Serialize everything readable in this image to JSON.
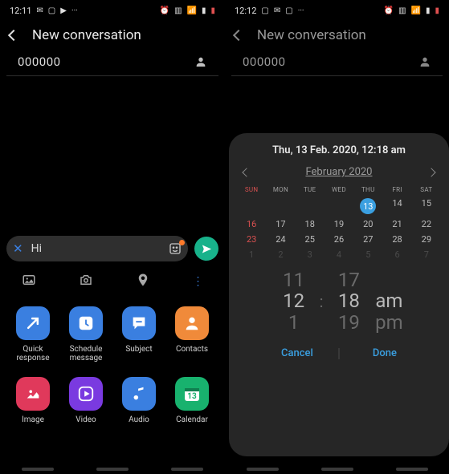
{
  "left": {
    "status": {
      "time": "12:11",
      "icons_left": [
        "📩",
        "▢",
        "▸",
        "···"
      ],
      "icons_right": [
        "⏰",
        "🗂",
        "📶",
        "📶",
        "🔋"
      ]
    },
    "header": {
      "title": "New conversation"
    },
    "recipient": {
      "value": "000000"
    },
    "compose": {
      "text": "Hi"
    },
    "toolbar": [
      "🖼",
      "📷",
      "📍",
      "⋮"
    ],
    "attachments": [
      {
        "label": "Quick\nresponse",
        "color": "c-blue",
        "icon": "↗"
      },
      {
        "label": "Schedule\nmessage",
        "color": "c-blue",
        "icon": "🕒"
      },
      {
        "label": "Subject",
        "color": "c-blue",
        "icon": "💬"
      },
      {
        "label": "Contacts",
        "color": "c-orange",
        "icon": "👤"
      },
      {
        "label": "Image",
        "color": "c-red",
        "icon": "🖼"
      },
      {
        "label": "Video",
        "color": "c-purple",
        "icon": "▶"
      },
      {
        "label": "Audio",
        "color": "c-blue",
        "icon": "♪"
      },
      {
        "label": "Calendar",
        "color": "c-green",
        "icon": "13"
      }
    ]
  },
  "right": {
    "status": {
      "time": "12:12",
      "icons_left": [
        "🖼",
        "📩",
        "▢",
        "···"
      ],
      "icons_right": [
        "⏰",
        "🗂",
        "📶",
        "📶",
        "🔋"
      ]
    },
    "header": {
      "title": "New conversation"
    },
    "recipient": {
      "value": "000000"
    },
    "picker": {
      "title": "Thu, 13 Feb. 2020, 12:18 am",
      "month": "February 2020",
      "dow": [
        "SUN",
        "MON",
        "TUE",
        "WED",
        "THU",
        "FRI",
        "SAT"
      ],
      "weeks": [
        [
          "",
          "",
          "",
          "",
          "13",
          "14",
          "15"
        ],
        [
          "16",
          "17",
          "18",
          "19",
          "20",
          "21",
          "22"
        ],
        [
          "23",
          "24",
          "25",
          "26",
          "27",
          "28",
          "29"
        ],
        [
          "1",
          "2",
          "3",
          "4",
          "5",
          "6",
          "7"
        ]
      ],
      "selected_day": "13",
      "time": {
        "hour_prev": "11",
        "hour": "12",
        "hour_next": "1",
        "min_prev": "17",
        "min": "18",
        "min_next": "19",
        "ampm": "am",
        "ampm_next": "pm"
      },
      "cancel": "Cancel",
      "done": "Done"
    }
  }
}
